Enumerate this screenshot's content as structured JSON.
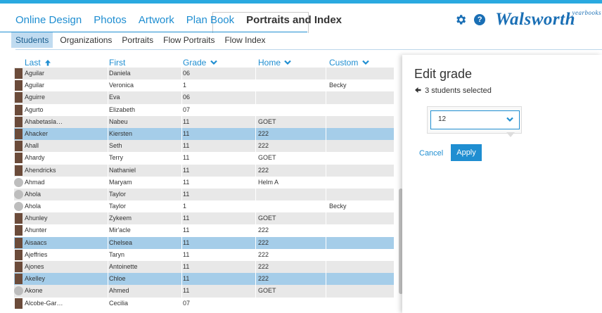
{
  "nav": {
    "tabs": [
      "Online Design",
      "Photos",
      "Artwork",
      "Plan Book",
      "Portraits and Index"
    ],
    "active_tab": "Portraits and Index",
    "help_label": "?",
    "logo": "Walsworth",
    "logo_sub": "yearbooks"
  },
  "subnav": {
    "tabs": [
      "Students",
      "Organizations",
      "Portraits",
      "Flow Portraits",
      "Flow Index"
    ],
    "active_tab": "Students"
  },
  "table": {
    "columns": [
      {
        "label": "Last",
        "icon": "arrow-up-icon"
      },
      {
        "label": "First",
        "icon": ""
      },
      {
        "label": "Grade",
        "icon": "chevron-down-icon"
      },
      {
        "label": "Home",
        "icon": "chevron-down-icon"
      },
      {
        "label": "Custom",
        "icon": "chevron-down-icon"
      }
    ],
    "rows": [
      {
        "last": "Aguilar",
        "first": "Daniela",
        "grade": "06",
        "home": "",
        "custom": "",
        "photo": "photo",
        "selected": false
      },
      {
        "last": "Aguilar",
        "first": "Veronica",
        "grade": "1",
        "home": "",
        "custom": "Becky",
        "photo": "photo",
        "selected": false
      },
      {
        "last": "Aguirre",
        "first": "Eva",
        "grade": "06",
        "home": "",
        "custom": "",
        "photo": "photo",
        "selected": false
      },
      {
        "last": "Agurto",
        "first": "Elizabeth",
        "grade": "07",
        "home": "",
        "custom": "",
        "photo": "photo",
        "selected": false
      },
      {
        "last": "Ahabetasla…",
        "first": "Nabeu",
        "grade": "11",
        "home": "GOET",
        "custom": "",
        "photo": "photo",
        "selected": false
      },
      {
        "last": "Ahacker",
        "first": "Kiersten",
        "grade": "11",
        "home": "222",
        "custom": "",
        "photo": "photo",
        "selected": true
      },
      {
        "last": "Ahall",
        "first": "Seth",
        "grade": "11",
        "home": "222",
        "custom": "",
        "photo": "photo",
        "selected": false
      },
      {
        "last": "Ahardy",
        "first": "Terry",
        "grade": "11",
        "home": "GOET",
        "custom": "",
        "photo": "photo",
        "selected": false
      },
      {
        "last": "Ahendricks",
        "first": "Nathaniel",
        "grade": "11",
        "home": "222",
        "custom": "",
        "photo": "photo",
        "selected": false
      },
      {
        "last": "Ahmad",
        "first": "Maryam",
        "grade": "11",
        "home": "Helm A",
        "custom": "",
        "photo": "placeholder",
        "selected": false
      },
      {
        "last": "Ahola",
        "first": "Taylor",
        "grade": "11",
        "home": "",
        "custom": "",
        "photo": "placeholder",
        "selected": false
      },
      {
        "last": "Ahola",
        "first": "Taylor",
        "grade": "1",
        "home": "",
        "custom": "Becky",
        "photo": "placeholder",
        "selected": false
      },
      {
        "last": "Ahunley",
        "first": "Zykeem",
        "grade": "11",
        "home": "GOET",
        "custom": "",
        "photo": "photo",
        "selected": false
      },
      {
        "last": "Ahunter",
        "first": "Mir'acle",
        "grade": "11",
        "home": "222",
        "custom": "",
        "photo": "photo",
        "selected": false
      },
      {
        "last": "Aisaacs",
        "first": "Chelsea",
        "grade": "11",
        "home": "222",
        "custom": "",
        "photo": "photo",
        "selected": true
      },
      {
        "last": "Ajeffries",
        "first": "Taryn",
        "grade": "11",
        "home": "222",
        "custom": "",
        "photo": "photo",
        "selected": false
      },
      {
        "last": "Ajones",
        "first": "Antoinette",
        "grade": "11",
        "home": "222",
        "custom": "",
        "photo": "photo",
        "selected": false
      },
      {
        "last": "Akelley",
        "first": "Chloe",
        "grade": "11",
        "home": "222",
        "custom": "",
        "photo": "photo",
        "selected": true
      },
      {
        "last": "Akone",
        "first": "Ahmed",
        "grade": "11",
        "home": "GOET",
        "custom": "",
        "photo": "placeholder",
        "selected": false
      },
      {
        "last": "Alcobe-Gar…",
        "first": "Cecilia",
        "grade": "07",
        "home": "",
        "custom": "",
        "photo": "photo",
        "selected": false
      }
    ]
  },
  "panel": {
    "title": "Edit grade",
    "back_text": "3 students selected",
    "dropdown_value": "12",
    "cancel_label": "Cancel",
    "apply_label": "Apply"
  },
  "colors": {
    "accent": "#1f8ed1",
    "selected_row": "#a5cde9",
    "alt_row": "#e8e8e8",
    "top_bar": "#2aa9e0"
  }
}
